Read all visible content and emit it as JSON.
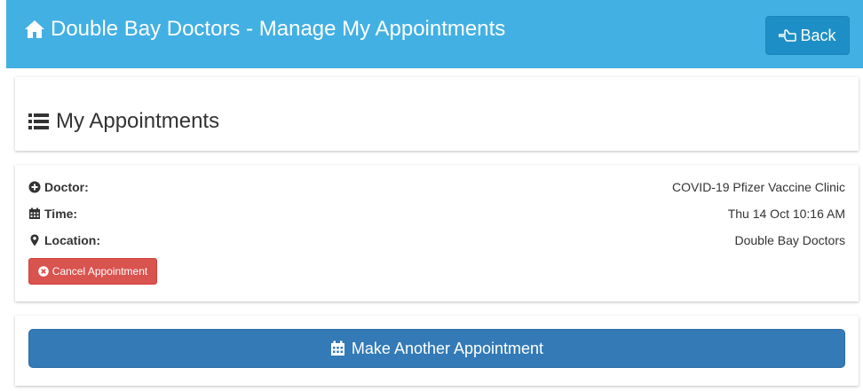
{
  "header": {
    "title": "Double Bay Doctors - Manage My Appointments",
    "back_label": "Back",
    "background_color": "#42b0e3",
    "icons": {
      "title": "home-icon",
      "back": "hand-point-left-icon"
    }
  },
  "appointments_panel": {
    "title": "My Appointments",
    "icon": "list-icon"
  },
  "appointment": {
    "doctor_label": "Doctor:",
    "doctor_value": "COVID-19 Pfizer Vaccine Clinic",
    "time_label": "Time:",
    "time_value": "Thu 14 Oct 10:16 AM",
    "location_label": "Location:",
    "location_value": "Double Bay Doctors",
    "cancel_label": "Cancel Appointment",
    "cancel_color": "#d9534f",
    "icons": {
      "doctor": "plus-circle-icon",
      "time": "calendar-icon",
      "location": "map-marker-icon",
      "cancel": "times-circle-icon"
    }
  },
  "make_another": {
    "label": "Make Another Appointment",
    "color": "#337ab7",
    "icon": "calendar-icon"
  }
}
